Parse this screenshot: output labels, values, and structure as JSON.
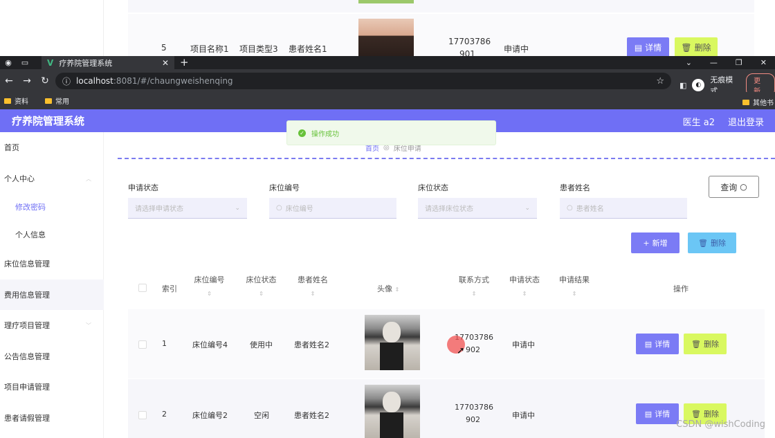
{
  "bg_window": {
    "row": {
      "index": "5",
      "project_name": "项目名称1",
      "project_type": "项目类型3",
      "patient": "患者姓名1",
      "phone_line1": "17703786",
      "phone_line2": "901",
      "status": "申请中",
      "detail": "详情",
      "delete": "删除"
    }
  },
  "browser": {
    "tab_title": "疗养院管理系统",
    "url_host": "localhost",
    "url_path": ":8081/#/chaungweishenqing",
    "incognito_label": "无痕模式",
    "update_label": "更新",
    "bookmarks": [
      "资料",
      "常用"
    ],
    "bookmarks_other": "其他书"
  },
  "header": {
    "title": "疗养院管理系统",
    "user": "医生 a2",
    "logout": "退出登录"
  },
  "sidebar": {
    "items": [
      {
        "label": "首页"
      },
      {
        "label": "个人中心"
      },
      {
        "label": "修改密码"
      },
      {
        "label": "个人信息"
      },
      {
        "label": "床位信息管理"
      },
      {
        "label": "费用信息管理"
      },
      {
        "label": "理疗项目管理"
      },
      {
        "label": "公告信息管理"
      },
      {
        "label": "项目申请管理"
      },
      {
        "label": "患者请假管理"
      }
    ]
  },
  "toast": {
    "text": "操作成功"
  },
  "breadcrumb": {
    "home": "首页",
    "current": "床位申请"
  },
  "filters": [
    {
      "label": "申请状态",
      "placeholder": "请选择申请状态"
    },
    {
      "label": "床位编号",
      "placeholder": "床位编号"
    },
    {
      "label": "床位状态",
      "placeholder": "请选择床位状态"
    },
    {
      "label": "患者姓名",
      "placeholder": "患者姓名"
    }
  ],
  "actions": {
    "query": "查询",
    "add": "新增",
    "delete": "删除"
  },
  "table": {
    "columns": {
      "index": "索引",
      "bed_no": "床位编号",
      "bed_status": "床位状态",
      "patient": "患者姓名",
      "avatar": "头像",
      "phone": "联系方式",
      "apply_status": "申请状态",
      "apply_result": "申请结果",
      "ops": "操作"
    },
    "rows": [
      {
        "index": "1",
        "bed_no": "床位编号4",
        "bed_status": "使用中",
        "patient": "患者姓名2",
        "phone_line1": "17703786",
        "phone_line2": "902",
        "apply_status": "申请中",
        "apply_result": "",
        "detail": "详情",
        "delete": "删除"
      },
      {
        "index": "2",
        "bed_no": "床位编号2",
        "bed_status": "空闲",
        "patient": "患者姓名2",
        "phone_line1": "17703786",
        "phone_line2": "902",
        "apply_status": "申请中",
        "apply_result": "",
        "detail": "详情",
        "delete": "删除"
      }
    ]
  },
  "watermark": "CSDN @wishCoding",
  "colors": {
    "accent": "#6f6ff5",
    "detail_btn": "#7b7bf5",
    "delete_btn": "#d9f860",
    "toast_green": "#67c23a"
  }
}
